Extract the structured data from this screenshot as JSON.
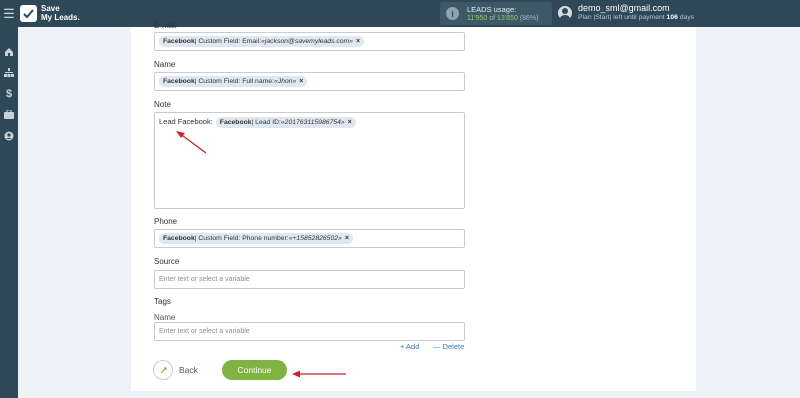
{
  "header": {
    "logo_line1": "Save",
    "logo_line2": "My Leads.",
    "usage_title": "LEADS usage:",
    "usage_used": "11'950",
    "usage_of": "of",
    "usage_total": "13'850",
    "usage_pct": "(86%)",
    "user_email": "demo_sml@gmail.com",
    "plan_text": "Plan |Start| left until payment",
    "plan_days": "106",
    "plan_days_suffix": "days"
  },
  "colors": {
    "accent": "#7fb342",
    "topbar": "#2f4858",
    "link": "#3a7bbf",
    "annotation": "#d0202a"
  },
  "icons": {
    "menu": "menu-icon",
    "sidebar": [
      "home-icon",
      "sitemap-icon",
      "dollar-icon",
      "briefcase-icon",
      "user-icon"
    ]
  },
  "form": {
    "email": {
      "label": "E-mail",
      "chip_source": "Facebook",
      "chip_text": " | Custom Field: Email: ",
      "chip_value": "«jackson@savemyleads.com»"
    },
    "name": {
      "label": "Name",
      "chip_source": "Facebook",
      "chip_text": " | Custom Field: Full name: ",
      "chip_value": "«Jhon»"
    },
    "note": {
      "label": "Note",
      "prefix": "Lead Facebook:",
      "chip_source": "Facebook",
      "chip_text": " | Lead ID: ",
      "chip_value": "«201763115986754»"
    },
    "phone": {
      "label": "Phone",
      "chip_source": "Facebook",
      "chip_text": " | Custom Field: Phone number: ",
      "chip_value": "«+15852826502»"
    },
    "source": {
      "label": "Source",
      "placeholder": "Enter text or select a variable"
    },
    "tags": {
      "label": "Tags",
      "name_label": "Name",
      "placeholder": "Enter text or select a variable"
    },
    "add_link": "+ Add",
    "delete_link": "— Delete",
    "back_label": "Back",
    "continue_label": "Continue"
  }
}
